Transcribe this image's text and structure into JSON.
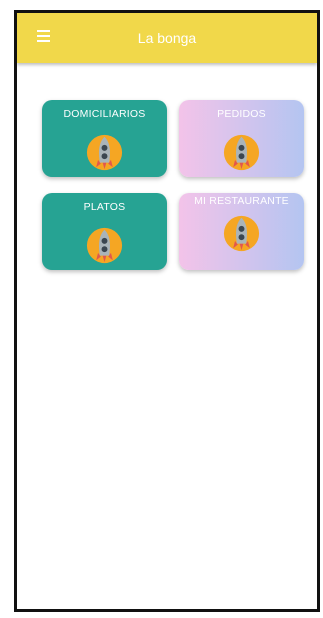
{
  "app": {
    "title": "La bonga",
    "menu_icon": "hamburger-menu-icon"
  },
  "colors": {
    "appbar": "#f1d84a",
    "card_teal": "#26a393",
    "card_gradient_start": "#f3c3e9",
    "card_gradient_end": "#b4c5f1",
    "rocket_circle": "#f5a623"
  },
  "cards": [
    {
      "label": "DOMICILIARIOS",
      "icon": "rocket-icon"
    },
    {
      "label": "PEDIDOS",
      "icon": "rocket-icon"
    },
    {
      "label": "PLATOS",
      "icon": "rocket-icon"
    },
    {
      "label": "MI RESTAURANTE",
      "icon": "rocket-icon"
    }
  ]
}
